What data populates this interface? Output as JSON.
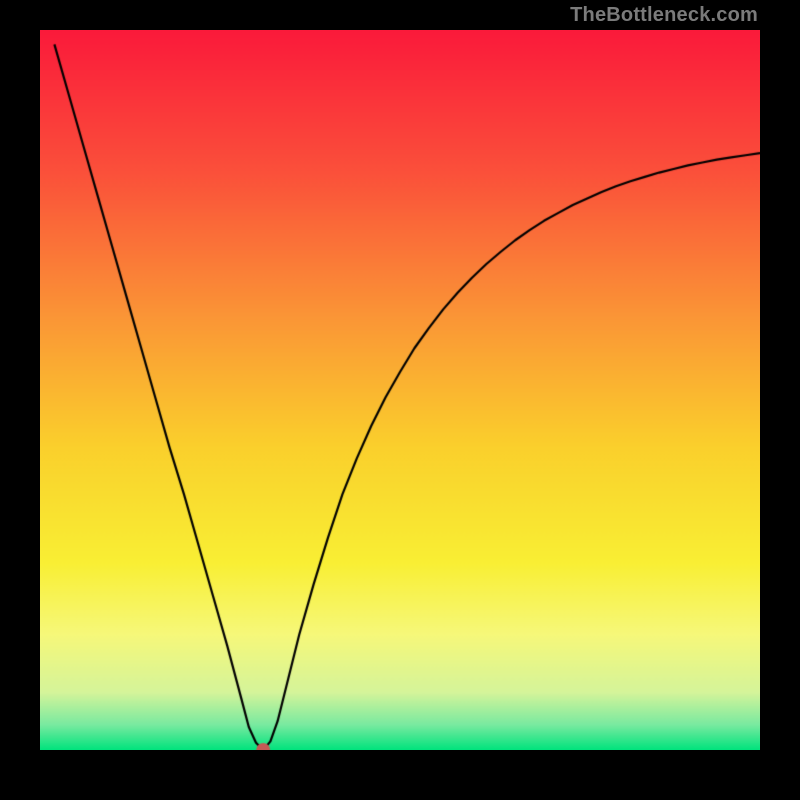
{
  "watermark": "TheBottleneck.com",
  "chart_data": {
    "type": "line",
    "title": "",
    "xlabel": "",
    "ylabel": "",
    "xlim": [
      0,
      100
    ],
    "ylim": [
      0,
      100
    ],
    "grid": false,
    "legend": false,
    "background_gradient_stops": [
      {
        "pos": 0.0,
        "color": "#fa1a3a"
      },
      {
        "pos": 0.2,
        "color": "#fb513a"
      },
      {
        "pos": 0.4,
        "color": "#fa9636"
      },
      {
        "pos": 0.58,
        "color": "#fad02c"
      },
      {
        "pos": 0.74,
        "color": "#f9ef34"
      },
      {
        "pos": 0.84,
        "color": "#f6f87a"
      },
      {
        "pos": 0.92,
        "color": "#d5f49a"
      },
      {
        "pos": 0.965,
        "color": "#79eaa0"
      },
      {
        "pos": 1.0,
        "color": "#00e37d"
      }
    ],
    "marker": {
      "x": 31,
      "y": 0,
      "color": "#c45a56",
      "radius_px": 7
    },
    "x": [
      2,
      4,
      6,
      8,
      10,
      12,
      14,
      16,
      18,
      20,
      22,
      24,
      26,
      28,
      29,
      30,
      31,
      32,
      33,
      34,
      36,
      38,
      40,
      42,
      44,
      46,
      48,
      50,
      52,
      54,
      56,
      58,
      60,
      62,
      64,
      66,
      68,
      70,
      72,
      74,
      76,
      78,
      80,
      82,
      84,
      86,
      88,
      90,
      92,
      94,
      96,
      98,
      100
    ],
    "y": [
      98.0,
      91.0,
      84.0,
      77.0,
      70.0,
      63.0,
      56.0,
      49.0,
      42.0,
      35.5,
      28.5,
      21.5,
      14.5,
      7.0,
      3.2,
      1.0,
      0.0,
      1.2,
      4.0,
      8.0,
      16.0,
      23.0,
      29.5,
      35.5,
      40.5,
      45.0,
      49.0,
      52.5,
      55.8,
      58.6,
      61.2,
      63.5,
      65.6,
      67.5,
      69.2,
      70.8,
      72.2,
      73.5,
      74.6,
      75.7,
      76.6,
      77.5,
      78.3,
      79.0,
      79.6,
      80.2,
      80.7,
      81.2,
      81.6,
      82.0,
      82.3,
      82.6,
      82.9
    ]
  }
}
